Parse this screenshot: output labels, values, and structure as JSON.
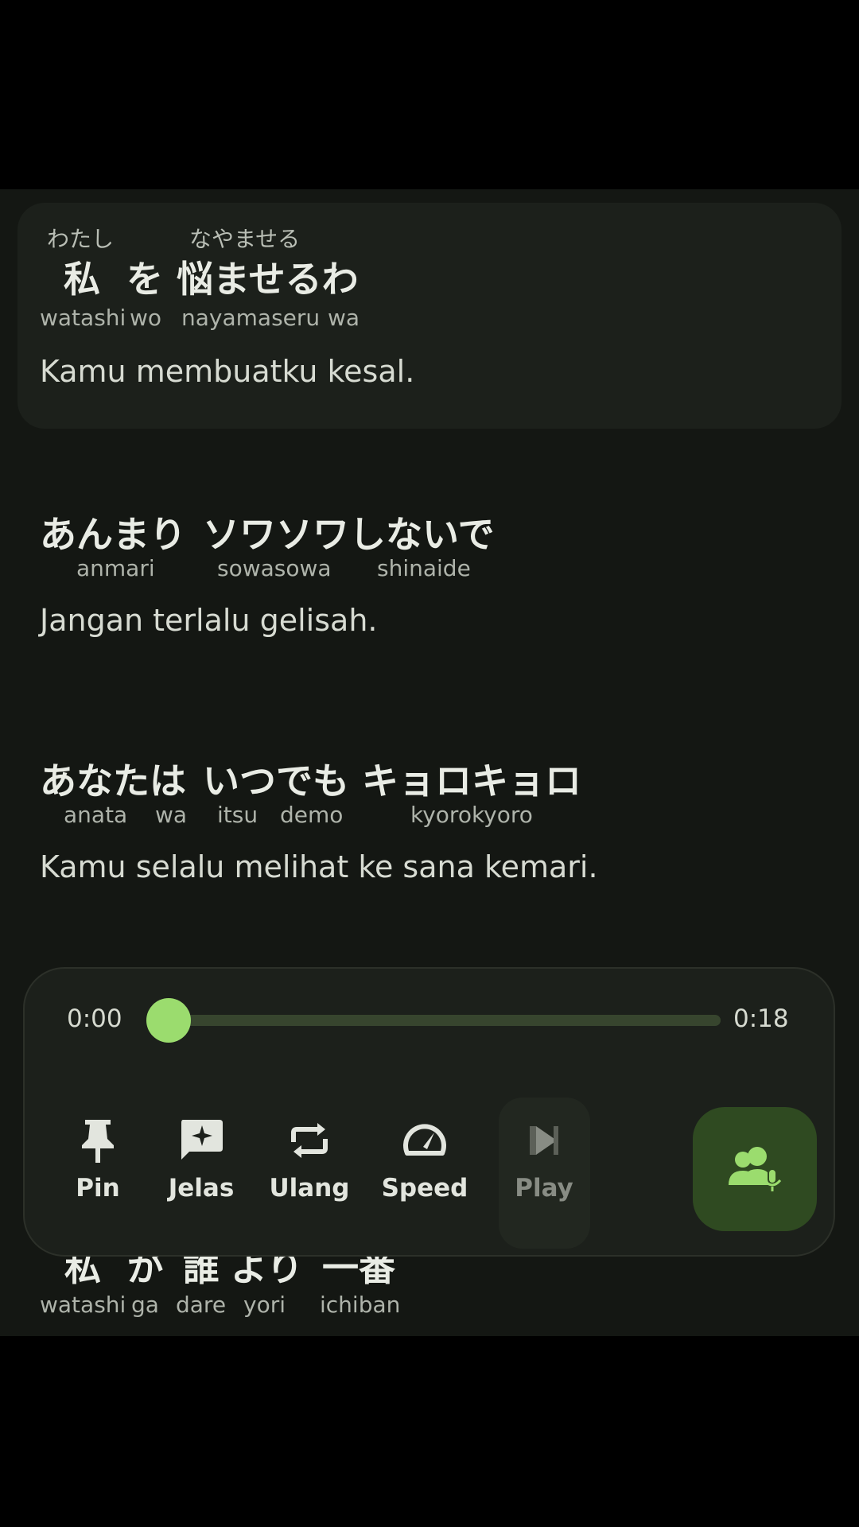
{
  "lines": [
    {
      "furigana": [
        "わたし",
        "なやませる"
      ],
      "japanese": [
        "私",
        "を",
        "悩ませるわ"
      ],
      "romaji": [
        "watashi",
        "wo",
        "nayamaseru",
        "wa"
      ],
      "translation": "Kamu membuatku kesal."
    },
    {
      "japanese": [
        "あんまり",
        "ソワソワしないで"
      ],
      "romaji": [
        "anmari",
        "sowasowa",
        "shinaide"
      ],
      "translation": "Jangan terlalu gelisah."
    },
    {
      "japanese": [
        "あなたは",
        "いつでも",
        "キョロキョロ"
      ],
      "romaji": [
        "anata",
        "wa",
        "itsu",
        "demo",
        "kyorokyoro"
      ],
      "translation": "Kamu selalu melihat ke sana kemari."
    },
    {
      "japanese": [
        "私",
        "が",
        "誰",
        "より",
        "一番"
      ],
      "romaji": [
        "watashi",
        "ga",
        "dare",
        "yori",
        "ichiban"
      ]
    }
  ],
  "player": {
    "current_time": "0:00",
    "total_time": "0:18",
    "progress": 0.0,
    "controls": [
      {
        "label": "Pin",
        "icon": "pin-icon"
      },
      {
        "label": "Jelas",
        "icon": "sparkle-chat-icon"
      },
      {
        "label": "Ulang",
        "icon": "repeat-icon"
      },
      {
        "label": "Speed",
        "icon": "speedometer-icon"
      },
      {
        "label": "Play",
        "icon": "play-icon"
      }
    ],
    "voice_button_icon": "group-voice-icon"
  },
  "colors": {
    "accent": "#9bdc6e",
    "voice_button_bg": "#2f4a21",
    "background": "#141713"
  }
}
